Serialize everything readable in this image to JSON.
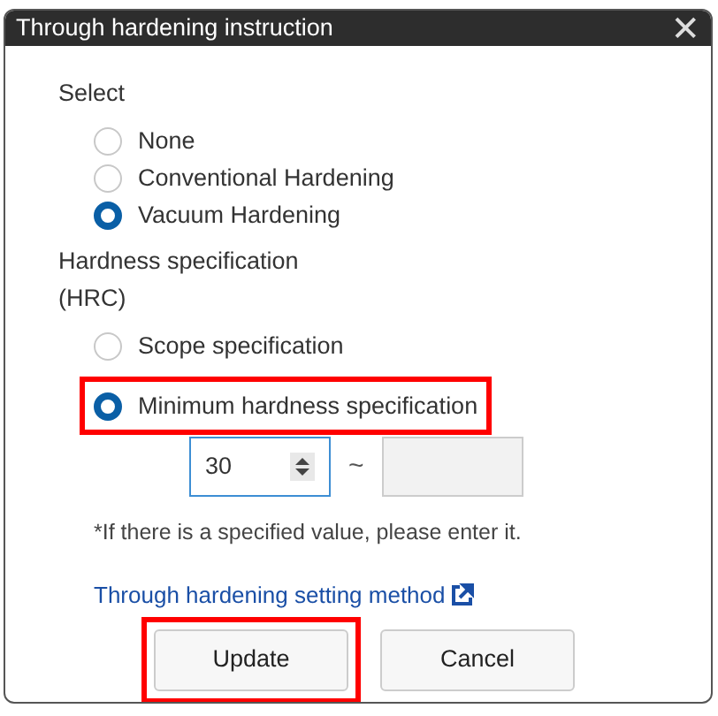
{
  "window": {
    "title": "Through hardening instruction",
    "close": "✕"
  },
  "select": {
    "label": "Select",
    "options": [
      {
        "label": "None",
        "selected": false
      },
      {
        "label": "Conventional Hardening",
        "selected": false
      },
      {
        "label": "Vacuum Hardening",
        "selected": true
      }
    ]
  },
  "hardness": {
    "label": "Hardness specification",
    "unit": "(HRC)",
    "options": [
      {
        "label": "Scope specification",
        "selected": false,
        "highlighted": false
      },
      {
        "label": "Minimum hardness specification",
        "selected": true,
        "highlighted": true
      }
    ],
    "min_value": "30",
    "separator": "~",
    "max_disabled": true
  },
  "note": "*If there is a specified value, please enter it.",
  "link": "Through hardening setting method",
  "buttons": [
    {
      "label": "Update",
      "highlighted": true
    },
    {
      "label": "Cancel",
      "highlighted": false
    }
  ]
}
